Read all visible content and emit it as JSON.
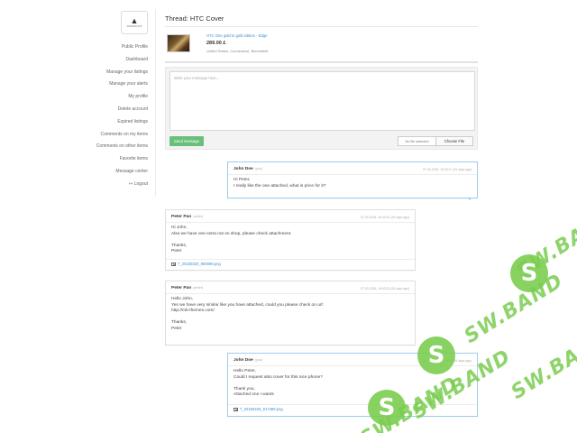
{
  "sidebar": {
    "logo_text": "ANDROID APP",
    "items": [
      {
        "label": "Public Profile"
      },
      {
        "label": "Dashboard"
      },
      {
        "label": "Manage your listings"
      },
      {
        "label": "Manage your alerts"
      },
      {
        "label": "My profile"
      },
      {
        "label": "Delete account"
      },
      {
        "label": "Expired listings"
      },
      {
        "label": "Comments on my items"
      },
      {
        "label": "Comments on other items"
      },
      {
        "label": "Favorite items"
      },
      {
        "label": "Message center"
      },
      {
        "label": "Logout",
        "icon": "logout-icon"
      }
    ]
  },
  "thread": {
    "title": "Thread: HTC Cover"
  },
  "product": {
    "name": "HTC One gold to gold edition - Edge",
    "price": "289.00 £",
    "location": "United States, Connecticut, Bloomfield"
  },
  "compose": {
    "placeholder": "Write your message here...",
    "send_label": "Send message",
    "file_status": "No file selected",
    "file_button": "Choose File"
  },
  "messages": [
    {
      "author": "John Doe",
      "role": "(you)",
      "date": "07-03-2016, 15:03:17 (26 days ago)",
      "lines": [
        "Hi Peter,",
        "I really like the one attached, what is price for it?"
      ],
      "own": true
    },
    {
      "author": "Peter Pan",
      "role": "(seller)",
      "date": "07-03-2016, 16:42:51 (26 days ago)",
      "lines": [
        "Hi John,",
        "Also we have one extra not on shop, please check attachment.",
        "",
        "Thanks,",
        "Peter"
      ],
      "attachment": "7_20160320_900099.png",
      "own": false
    },
    {
      "author": "Peter Pan",
      "role": "(seller)",
      "date": "07-03-2016, 16:52:23 (26 days ago)",
      "lines": [
        "Hello John,",
        "Yes we have very similar like you have attached, could you please check on url:",
        "http://mb-themes.com/",
        "",
        "Thanks,",
        "Peter"
      ],
      "own": false
    },
    {
      "author": "John Doe",
      "role": "(you)",
      "date": "07-03-2016, 17:08:49 (26 days ago)",
      "lines": [
        "Hello Peter,",
        "Could I request also cover for this nice phone?",
        "",
        "Thank you,",
        "Attached one I wants"
      ],
      "attachment": "7_20160325_917399.png",
      "own": true
    }
  ],
  "watermark": {
    "text": "SW.BAND",
    "color": "#7acd50"
  }
}
